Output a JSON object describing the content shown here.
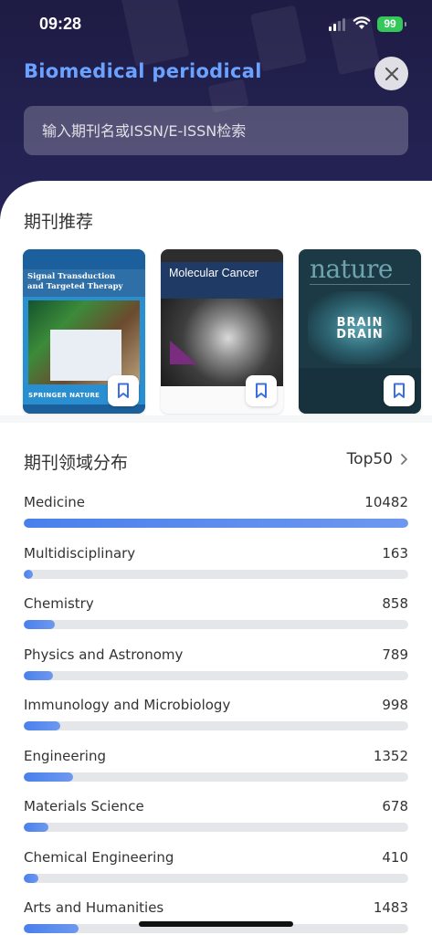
{
  "status_bar": {
    "time": "09:28",
    "battery": "99"
  },
  "header": {
    "title": "Biomedical periodical",
    "search_placeholder": "输入期刊名或ISSN/E-ISSN检索"
  },
  "recommend": {
    "title": "期刊推荐",
    "journals": [
      {
        "title": "Signal Transduction and Targeted Therapy",
        "publisher": "SPRINGER NATURE"
      },
      {
        "title": "Molecular Cancer"
      },
      {
        "title": "nature",
        "headline": "BRAIN DRAIN"
      }
    ]
  },
  "distribution": {
    "title": "期刊领域分布",
    "more_label": "Top50",
    "max_value": 10482,
    "items": [
      {
        "name": "Medicine",
        "count": "10482",
        "value": 10482
      },
      {
        "name": "Multidisciplinary",
        "count": "163",
        "value": 163
      },
      {
        "name": "Chemistry",
        "count": "858",
        "value": 858
      },
      {
        "name": "Physics and Astronomy",
        "count": "789",
        "value": 789
      },
      {
        "name": "Immunology and Microbiology",
        "count": "998",
        "value": 998
      },
      {
        "name": "Engineering",
        "count": "1352",
        "value": 1352
      },
      {
        "name": "Materials Science",
        "count": "678",
        "value": 678
      },
      {
        "name": "Chemical Engineering",
        "count": "410",
        "value": 410
      },
      {
        "name": "Arts and Humanities",
        "count": "1483",
        "value": 1483
      }
    ]
  },
  "colors": {
    "accent": "#4a80ec",
    "header_bg": "#232150",
    "title": "#6ca2ff",
    "battery": "#34c759"
  },
  "icons": [
    "signal-icon",
    "wifi-icon",
    "battery-icon",
    "close-icon",
    "bookmark-icon",
    "chevron-right-icon"
  ]
}
